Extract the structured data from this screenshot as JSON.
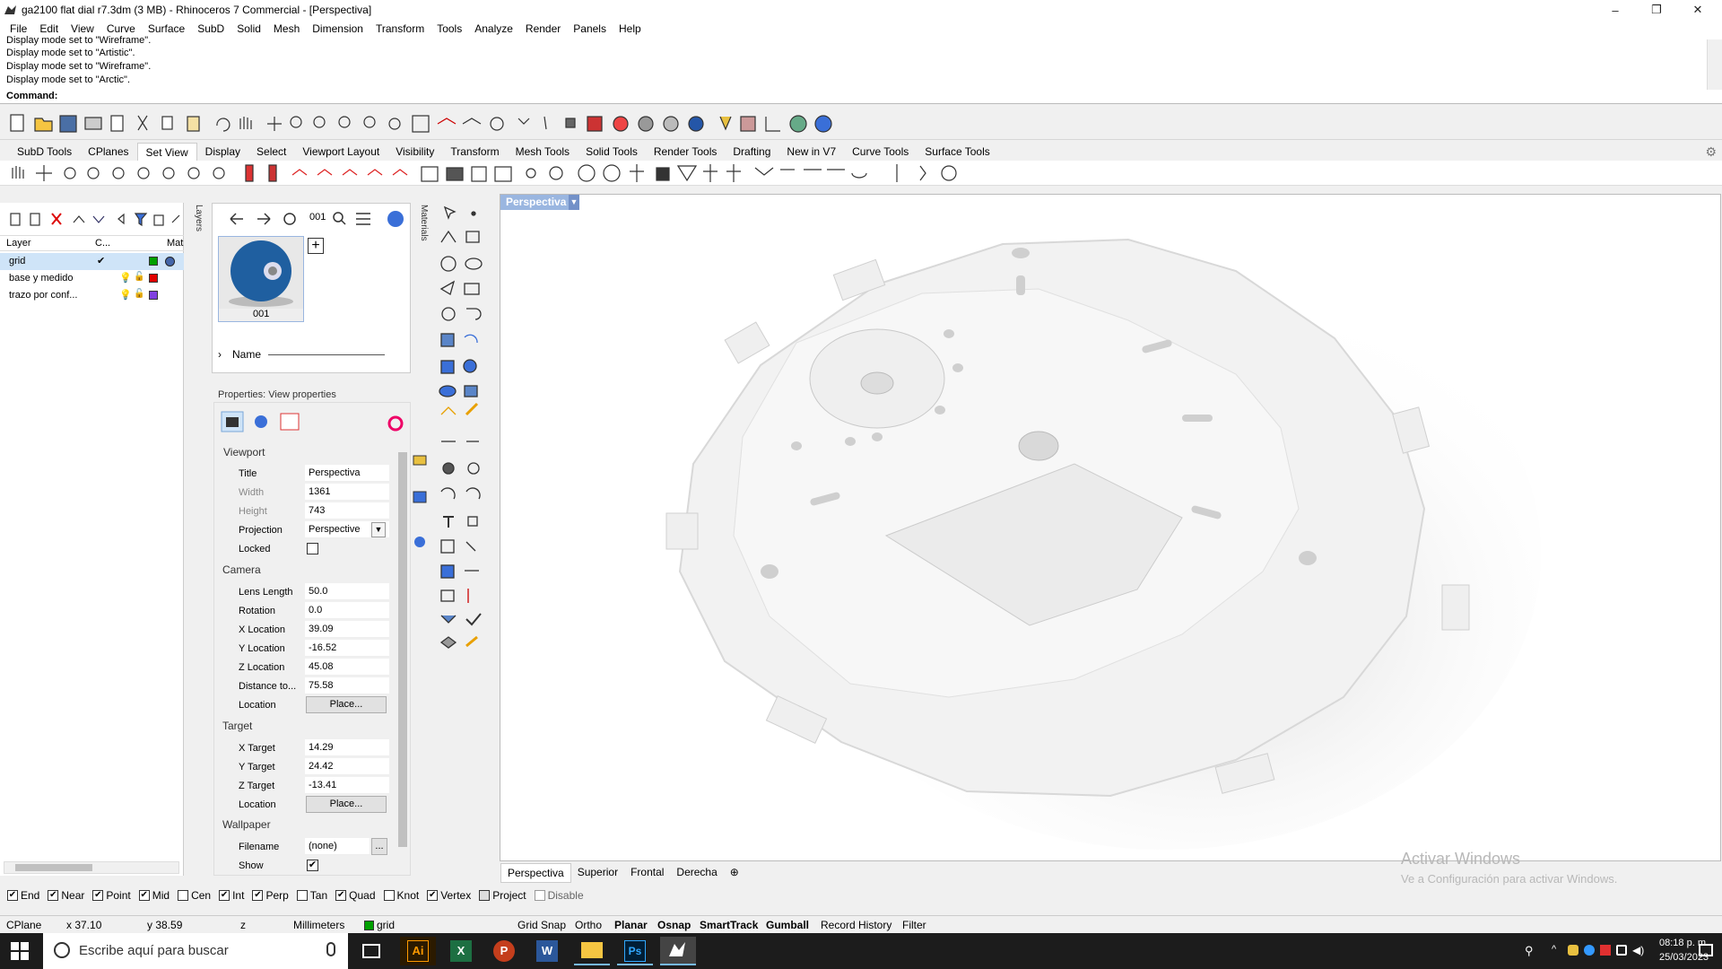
{
  "window": {
    "title": "ga2100 flat dial r7.3dm (3 MB) - Rhinoceros 7 Commercial - [Perspectiva]",
    "minimize": "–",
    "restore": "❐",
    "close": "✕"
  },
  "menu": [
    "File",
    "Edit",
    "View",
    "Curve",
    "Surface",
    "SubD",
    "Solid",
    "Mesh",
    "Dimension",
    "Transform",
    "Tools",
    "Analyze",
    "Render",
    "Panels",
    "Help"
  ],
  "history": {
    "lines": [
      "Display mode set to \"Wireframe\".",
      "Display mode set to \"Artistic\".",
      "Display mode set to \"Wireframe\".",
      "Display mode set to \"Arctic\"."
    ],
    "command_label": "Command:"
  },
  "tabs": [
    "SubD Tools",
    "CPlanes",
    "Set View",
    "Display",
    "Select",
    "Viewport Layout",
    "Visibility",
    "Transform",
    "Mesh Tools",
    "Solid Tools",
    "Render Tools",
    "Drafting",
    "New in V7",
    "Curve Tools",
    "Surface Tools"
  ],
  "active_tab": "Set View",
  "layers": {
    "panel_tab": "Layers",
    "headers": {
      "layer": "Layer",
      "cplane": "C...",
      "mat": "Mat"
    },
    "items": [
      {
        "name": "grid",
        "color": "#00a000",
        "selected": true,
        "check": "✔"
      },
      {
        "name": "base y medido",
        "color": "#e00000",
        "selected": false,
        "check": ""
      },
      {
        "name": "trazo por conf...",
        "color": "#8040e0",
        "selected": false,
        "check": ""
      }
    ]
  },
  "materials": {
    "panel_tab": "Materials",
    "search_value": "001",
    "thumb_label": "001",
    "name_header": "Name"
  },
  "properties": {
    "header": "Properties: View properties",
    "viewport_group": "Viewport",
    "camera_group": "Camera",
    "target_group": "Target",
    "wallpaper_group": "Wallpaper",
    "viewport": [
      {
        "label": "Title",
        "value": "Perspectiva",
        "dim": false
      },
      {
        "label": "Width",
        "value": "1361",
        "dim": true
      },
      {
        "label": "Height",
        "value": "743",
        "dim": true
      },
      {
        "label": "Projection",
        "value": "Perspective",
        "dim": false
      },
      {
        "label": "Locked",
        "value": "",
        "dim": false
      }
    ],
    "camera": [
      {
        "label": "Lens Length",
        "value": "50.0"
      },
      {
        "label": "Rotation",
        "value": "0.0"
      },
      {
        "label": "X Location",
        "value": "39.09"
      },
      {
        "label": "Y Location",
        "value": "-16.52"
      },
      {
        "label": "Z Location",
        "value": "45.08"
      },
      {
        "label": "Distance to...",
        "value": "75.58"
      },
      {
        "label": "Location",
        "value": "Place..."
      }
    ],
    "target": [
      {
        "label": "X Target",
        "value": "14.29"
      },
      {
        "label": "Y Target",
        "value": "24.42"
      },
      {
        "label": "Z Target",
        "value": "-13.41"
      },
      {
        "label": "Location",
        "value": "Place..."
      }
    ],
    "wallpaper": [
      {
        "label": "Filename",
        "value": "(none)"
      },
      {
        "label": "Show",
        "value": "✔"
      }
    ],
    "ellipsis": "..."
  },
  "viewport": {
    "title": "Perspectiva",
    "tabs": [
      "Perspectiva",
      "Superior",
      "Frontal",
      "Derecha"
    ],
    "add_tab": "⊕",
    "watermark_title": "Activar Windows",
    "watermark_sub": "Ve a Configuración para activar Windows."
  },
  "osnaps": [
    {
      "label": "End",
      "checked": true
    },
    {
      "label": "Near",
      "checked": true
    },
    {
      "label": "Point",
      "checked": true
    },
    {
      "label": "Mid",
      "checked": true
    },
    {
      "label": "Cen",
      "checked": false
    },
    {
      "label": "Int",
      "checked": true
    },
    {
      "label": "Perp",
      "checked": true
    },
    {
      "label": "Tan",
      "checked": false
    },
    {
      "label": "Quad",
      "checked": true
    },
    {
      "label": "Knot",
      "checked": false
    },
    {
      "label": "Vertex",
      "checked": true
    },
    {
      "label": "Project",
      "checked": false
    },
    {
      "label": "Disable",
      "checked": false
    }
  ],
  "status": {
    "cplane": "CPlane",
    "x": "x 37.10",
    "y": "y 38.59",
    "z": "z",
    "units": "Millimeters",
    "layer": "grid",
    "layer_color": "#00a000",
    "panes": [
      {
        "label": "Grid Snap",
        "bold": false
      },
      {
        "label": "Ortho",
        "bold": false
      },
      {
        "label": "Planar",
        "bold": true
      },
      {
        "label": "Osnap",
        "bold": true
      },
      {
        "label": "SmartTrack",
        "bold": true
      },
      {
        "label": "Gumball",
        "bold": true
      },
      {
        "label": "Record History",
        "bold": false
      },
      {
        "label": "Filter",
        "bold": false
      }
    ]
  },
  "taskbar": {
    "search_placeholder": "Escribe aquí para buscar",
    "time": "08:18 p. m.",
    "date": "25/03/2023"
  }
}
